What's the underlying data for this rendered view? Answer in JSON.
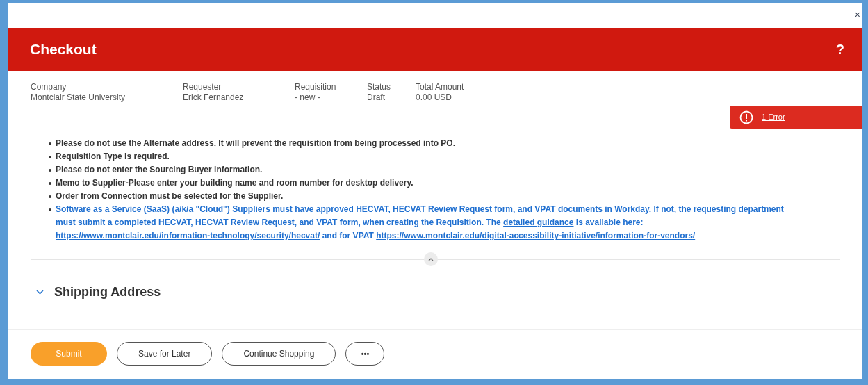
{
  "close": "×",
  "header": {
    "title": "Checkout",
    "help": "?"
  },
  "summary": [
    {
      "label": "Company",
      "value": "Montclair State University"
    },
    {
      "label": "Requester",
      "value": "Erick Fernandez"
    },
    {
      "label": "Requisition",
      "value": "- new -"
    },
    {
      "label": "Status",
      "value": "Draft"
    },
    {
      "label": "Total Amount",
      "value": "0.00 USD"
    }
  ],
  "error_badge": {
    "label": "1 Error"
  },
  "notes": [
    {
      "kind": "plain",
      "segments": [
        {
          "text": "Please do not use the Alternate address. It will prevent the requisition from being processed into PO.",
          "link": false
        }
      ]
    },
    {
      "kind": "plain",
      "segments": [
        {
          "text": "Requisition Type is required.",
          "link": false
        }
      ]
    },
    {
      "kind": "plain",
      "segments": [
        {
          "text": "Please do not enter the Sourcing Buyer information.",
          "link": false
        }
      ]
    },
    {
      "kind": "plain",
      "segments": [
        {
          "text": "Memo to Supplier-Please enter your building name and room number for desktop delivery.",
          "link": false
        }
      ]
    },
    {
      "kind": "plain",
      "segments": [
        {
          "text": "Order from Connection must be selected for the Supplier.",
          "link": false
        }
      ]
    },
    {
      "kind": "notice",
      "segments": [
        {
          "text": "Software as a Service (SaaS) (a/k/a \"Cloud\") Suppliers must have approved HECVAT, HECVAT Review Request form, and VPAT documents in Workday. If not, the requesting department must submit a completed HECVAT, HECVAT Review Request, and VPAT form, when creating the Requisition. The",
          "link": false
        },
        {
          "text": "detailed guidance",
          "link": true
        },
        {
          "text": "is available here:",
          "link": false
        },
        {
          "text": "https://www.montclair.edu/information-technology/security/hecvat/",
          "link": true
        },
        {
          "text": "and for VPAT",
          "link": false
        },
        {
          "text": "https://www.montclair.edu/digital-accessibility-initiative/information-for-vendors/",
          "link": true
        }
      ]
    }
  ],
  "section": {
    "title": "Shipping Address",
    "expanded": true
  },
  "buttons": [
    {
      "kind": "primary",
      "label": "Submit"
    },
    {
      "kind": "outline",
      "label": "Save for Later"
    },
    {
      "kind": "outline",
      "label": "Continue Shopping"
    },
    {
      "kind": "more",
      "label": "•••"
    }
  ]
}
